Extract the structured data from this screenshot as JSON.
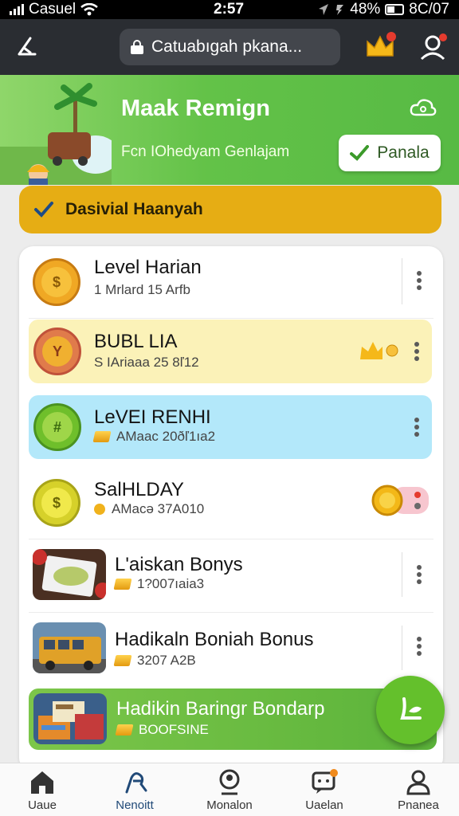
{
  "status_bar": {
    "carrier": "Casuel",
    "time": "2:57",
    "battery": "48%",
    "extra": "8C/07"
  },
  "top_bar": {
    "url": "Catuabıgah pkana..."
  },
  "banner": {
    "title": "Maak Remign",
    "subtitle": "Fcn IOhedyam Genlajam",
    "button_label": "Panala"
  },
  "notice": {
    "text": "Dasivial Haanyah"
  },
  "list": [
    {
      "title": "Level Harian",
      "subtitle": "1  Mrlard 15 Arfb"
    },
    {
      "title": "BUBL LIA",
      "subtitle": "S  IAriaaa 25 8ľ12"
    },
    {
      "title": "LeVEI RENHI",
      "subtitle": "AMaac 20ðľ1ıa2"
    },
    {
      "title": "SalHLDAY",
      "subtitle": "AMacə 37A010"
    },
    {
      "title": "L'aiskan Bonys",
      "subtitle": "1?007ıaia3"
    },
    {
      "title": "Hadikaln Boniah Bonus",
      "subtitle": "3207 A2B"
    },
    {
      "title": "Hadikin Baringr Bondarp",
      "subtitle": "BOOFSINE"
    }
  ],
  "bottom_nav": [
    {
      "label": "Uaue",
      "icon": "home-icon"
    },
    {
      "label": "Nenoitt",
      "icon": "spark-icon"
    },
    {
      "label": "Monalon",
      "icon": "person-badge-icon"
    },
    {
      "label": "Uaelan",
      "icon": "chat-icon"
    },
    {
      "label": "Pnanea",
      "icon": "profile-icon"
    }
  ],
  "colors": {
    "accent_green": "#5bbd45",
    "notice_yellow": "#e6ad14",
    "tint_yellow": "#fbf2b8",
    "tint_blue": "#b3e8fa",
    "topbar": "#2a2d32"
  }
}
